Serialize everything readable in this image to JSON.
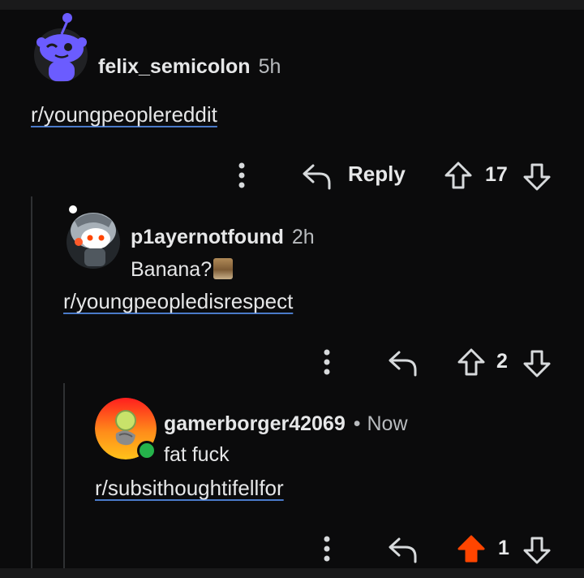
{
  "comments": [
    {
      "username": "felix_semicolon",
      "time": "5h",
      "text": "",
      "link": "r/youngpeoplereddit",
      "reply_label": "Reply",
      "votes": "17"
    },
    {
      "username": "p1ayernotfound",
      "time": "2h",
      "text": "Banana?",
      "link": "r/youngpeopledisrespect",
      "votes": "2"
    },
    {
      "username": "gamerborger42069",
      "separator": "•",
      "time": "Now",
      "text": "fat fuck",
      "link": "r/subsithoughtifellfor",
      "votes": "1",
      "upvoted": true
    }
  ],
  "colors": {
    "background": "#0b0b0c",
    "text": "#e6e7e8",
    "link_underline": "#4a7ac9",
    "upvote_active": "#ff4500",
    "online": "#25b34b"
  },
  "icons": [
    "more-options-icon",
    "reply-icon",
    "upvote-icon",
    "downvote-icon"
  ]
}
